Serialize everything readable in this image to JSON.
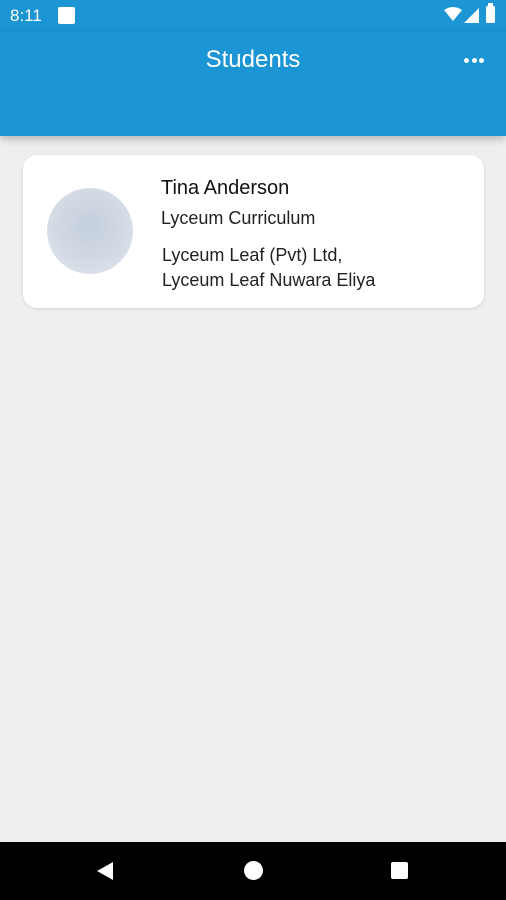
{
  "status_bar": {
    "time": "8:11",
    "icons": [
      "notification-square-icon",
      "wifi-icon",
      "signal-icon",
      "battery-icon"
    ]
  },
  "app_bar": {
    "title": "Students",
    "menu_icon": "more-horiz-icon",
    "color": "#1b95d4"
  },
  "students": [
    {
      "name": "Tina Anderson",
      "curriculum": "Lyceum Curriculum",
      "school_line1": "Lyceum Leaf (Pvt) Ltd,",
      "school_line2": "Lyceum Leaf Nuwara Eliya"
    }
  ],
  "nav_bar": {
    "icons": [
      "back-icon",
      "home-icon",
      "recents-icon"
    ]
  }
}
